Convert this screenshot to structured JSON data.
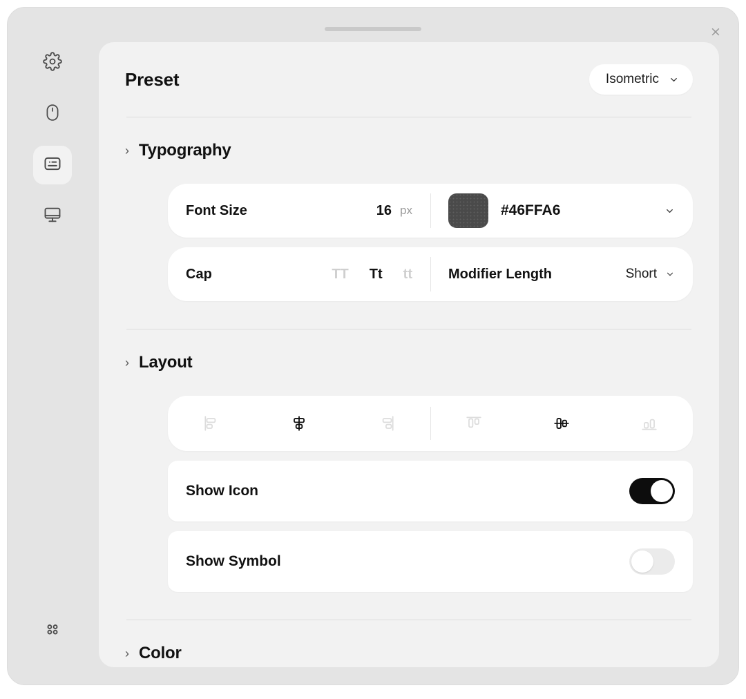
{
  "window": {
    "drag_handle": "window-drag-handle",
    "close_label": "×"
  },
  "sidebar": {
    "items": [
      {
        "name": "settings",
        "icon": "gear-icon",
        "active": false
      },
      {
        "name": "mouse",
        "icon": "mouse-icon",
        "active": false
      },
      {
        "name": "caption",
        "icon": "caption-icon",
        "active": true
      },
      {
        "name": "display",
        "icon": "monitor-icon",
        "active": false
      }
    ],
    "bottom_item": {
      "name": "apps",
      "icon": "grid-dots-icon"
    }
  },
  "preset": {
    "title": "Preset",
    "selected": "Isometric",
    "chevron": "chevron-down-icon"
  },
  "sections": {
    "typography": {
      "title": "Typography",
      "chevron": "›",
      "font_size": {
        "label": "Font Size",
        "value": "16",
        "unit": "px"
      },
      "color": {
        "hex": "#46FFA6",
        "swatch_color": "#4a4a4a"
      },
      "cap": {
        "label": "Cap",
        "options": [
          "TT",
          "Tt",
          "tt"
        ],
        "selected_index": 1
      },
      "modifier_length": {
        "label": "Modifier Length",
        "value": "Short"
      }
    },
    "layout": {
      "title": "Layout",
      "chevron": "›",
      "align_horizontal": {
        "options": [
          "align-left-icon",
          "align-center-icon",
          "align-right-icon"
        ],
        "selected_index": 1
      },
      "align_vertical": {
        "options": [
          "align-top-icon",
          "align-middle-icon",
          "align-bottom-icon"
        ],
        "selected_index": 1
      },
      "show_icon": {
        "label": "Show Icon",
        "on": true
      },
      "show_symbol": {
        "label": "Show Symbol",
        "on": false
      }
    },
    "color": {
      "title": "Color",
      "chevron": "›"
    }
  },
  "colors": {
    "window_bg": "#e4e4e4",
    "panel_bg": "#f2f2f2",
    "row_bg": "#ffffff",
    "accent_on": "#0d0d0d",
    "muted": "#cfcfcf"
  }
}
